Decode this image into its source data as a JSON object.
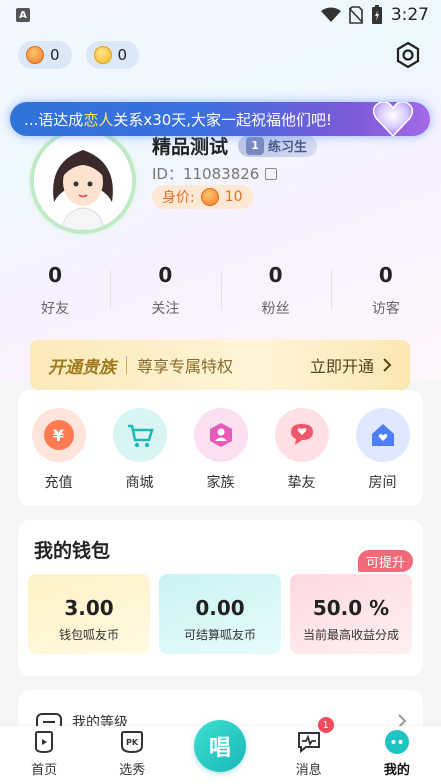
{
  "status_bar": {
    "time": "3:27",
    "app_icon_letter": "A"
  },
  "top": {
    "coin_a": "0",
    "coin_b": "0"
  },
  "banner": {
    "text_prefix": "...语达成",
    "text_highlight": "恋人",
    "text_suffix": "关系x30天,大家一起祝福他们吧!"
  },
  "profile": {
    "name": "精品测试",
    "level_num": "1",
    "level_title": "练习生",
    "id_text": "ID：11083826",
    "worth_label": "身价:",
    "worth_value": "10"
  },
  "stats": [
    {
      "value": "0",
      "label": "好友"
    },
    {
      "value": "0",
      "label": "关注"
    },
    {
      "value": "0",
      "label": "粉丝"
    },
    {
      "value": "0",
      "label": "访客"
    }
  ],
  "vip": {
    "title": "开通贵族",
    "subtitle": "尊享专属特权",
    "action": "立即开通"
  },
  "shortcuts": [
    {
      "label": "充值",
      "icon": "yen-icon"
    },
    {
      "label": "商城",
      "icon": "cart-icon"
    },
    {
      "label": "家族",
      "icon": "family-icon"
    },
    {
      "label": "挚友",
      "icon": "chat-heart-icon"
    },
    {
      "label": "房间",
      "icon": "house-icon"
    }
  ],
  "wallet": {
    "title": "我的钱包",
    "badge": "可提升",
    "items": [
      {
        "value": "3.00",
        "label": "钱包呱友币"
      },
      {
        "value": "0.00",
        "label": "可结算呱友币"
      },
      {
        "value": "50.0 %",
        "label": "当前最高收益分成"
      }
    ]
  },
  "level_row": {
    "label": "我的等级"
  },
  "tabs": [
    {
      "label": "首页"
    },
    {
      "label": "选秀"
    },
    {
      "label": "唱"
    },
    {
      "label": "消息",
      "badge": "1"
    },
    {
      "label": "我的"
    }
  ],
  "colors": {
    "accent": "#1fc3c3",
    "vip_gold": "#a07a20",
    "badge_red": "#f06a7a"
  }
}
